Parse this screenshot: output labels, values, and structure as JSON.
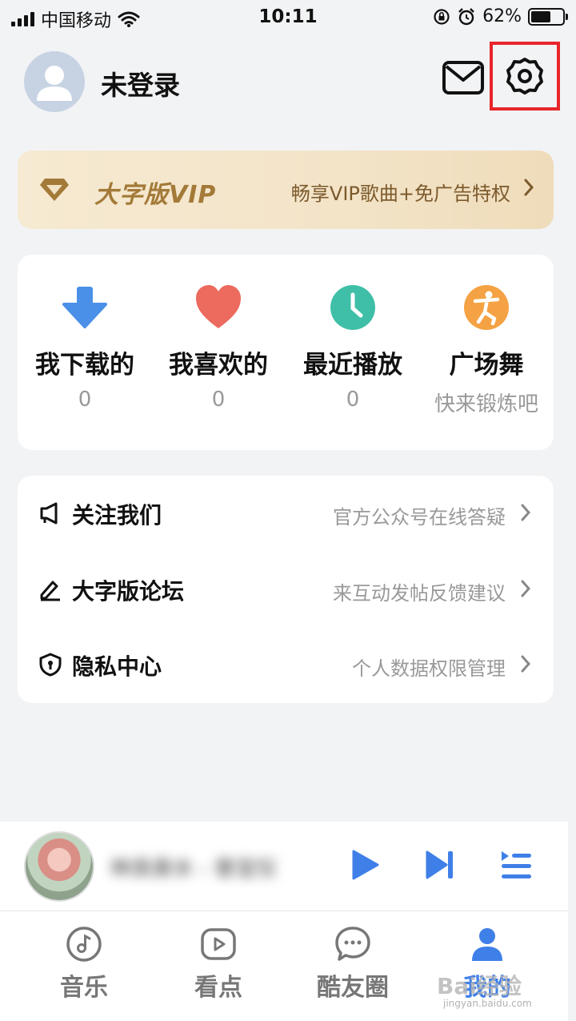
{
  "status_bar": {
    "carrier": "中国移动",
    "time": "10:11",
    "battery": "62%",
    "battery_level": 0.62
  },
  "header": {
    "user_name": "未登录"
  },
  "vip": {
    "title": "大字版VIP",
    "description": "畅享VIP歌曲+免广告特权"
  },
  "quick_items": [
    {
      "label": "我下载的",
      "value": "0",
      "icon": "download-arrow-icon",
      "color": "#4a90e8"
    },
    {
      "label": "我喜欢的",
      "value": "0",
      "icon": "heart-icon",
      "color": "#ec6a5e"
    },
    {
      "label": "最近播放",
      "value": "0",
      "icon": "clock-icon",
      "color": "#3fbfa8"
    },
    {
      "label": "广场舞",
      "value": "快来锻炼吧",
      "icon": "dancer-icon",
      "color": "#f4a243"
    }
  ],
  "list_items": [
    {
      "label": "关注我们",
      "description": "官方公众号在线答疑",
      "icon": "megaphone-icon"
    },
    {
      "label": "大字版论坛",
      "description": "来互动发帖反馈建议",
      "icon": "pencil-icon"
    },
    {
      "label": "隐私中心",
      "description": "个人数据权限管理",
      "icon": "shield-lock-icon"
    }
  ],
  "player": {
    "song_title": "林良泉水 - 曾宝仪"
  },
  "tabs": [
    {
      "label": "音乐",
      "icon": "music-note-icon",
      "active": false
    },
    {
      "label": "看点",
      "icon": "play-video-icon",
      "active": false
    },
    {
      "label": "酷友圈",
      "icon": "chat-bubble-icon",
      "active": false
    },
    {
      "label": "我的",
      "icon": "person-icon",
      "active": true
    }
  ],
  "watermark": {
    "text": "Bai经验",
    "subtext": "jingyan.baidu.com"
  },
  "colors": {
    "accent": "#3f7fe8",
    "highlight_box": "#e8252b",
    "vip_gold": "#a37a38"
  }
}
